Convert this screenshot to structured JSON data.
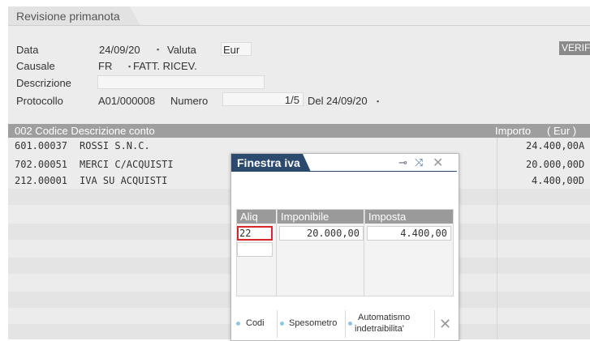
{
  "window": {
    "tab_title": "Revisione primanota"
  },
  "header": {
    "data_label": "Data",
    "data_value": "24/09/20",
    "valuta_label": "Valuta",
    "valuta_value": "Eur",
    "causale_label": "Causale",
    "causale_code": "FR",
    "causale_desc": "FATT. RICEV.",
    "descrizione_label": "Descrizione",
    "descrizione_value": "",
    "protocollo_label": "Protocollo",
    "protocollo_value": "A01/000008",
    "numero_label": "Numero",
    "numero_value": "1/5",
    "del_label": "Del",
    "del_value": "24/09/20",
    "verif_label": "VERIF"
  },
  "grid": {
    "col_codice": "002  Codice Descrizione conto",
    "col_importo": "Importo",
    "col_currency": "( Eur )",
    "rows": [
      {
        "codice": "601.00037",
        "descrizione": "ROSSI S.N.C.",
        "importo": "24.400,00A"
      },
      {
        "codice": "702.00051",
        "descrizione": "MERCI C/ACQUISTI",
        "importo": "20.000,00D"
      },
      {
        "codice": "212.00001",
        "descrizione": "IVA SU ACQUISTI",
        "importo": "4.400,00D"
      }
    ]
  },
  "popup": {
    "title": "Finestra iva",
    "columns": {
      "aliq": "Aliq",
      "imponibile": "Imponibile",
      "imposta": "Imposta"
    },
    "rows": [
      {
        "aliq": "22",
        "imponibile": "20.000,00",
        "imposta": "4.400,00"
      }
    ],
    "buttons": {
      "codi": "Codi",
      "spesometro": "Spesometro",
      "automatismo_1": "Automatismo",
      "automatismo_2": "indetraibilita'"
    }
  },
  "icons": [
    "pin-icon",
    "collapse-icon",
    "close-icon",
    "close-x-icon"
  ],
  "colors": {
    "popup_title_bg": "#2c4a6e",
    "grid_header_bg": "#9e9e9e",
    "active_cell_border": "#d9262a",
    "button_dot": "#8fc7e6"
  }
}
